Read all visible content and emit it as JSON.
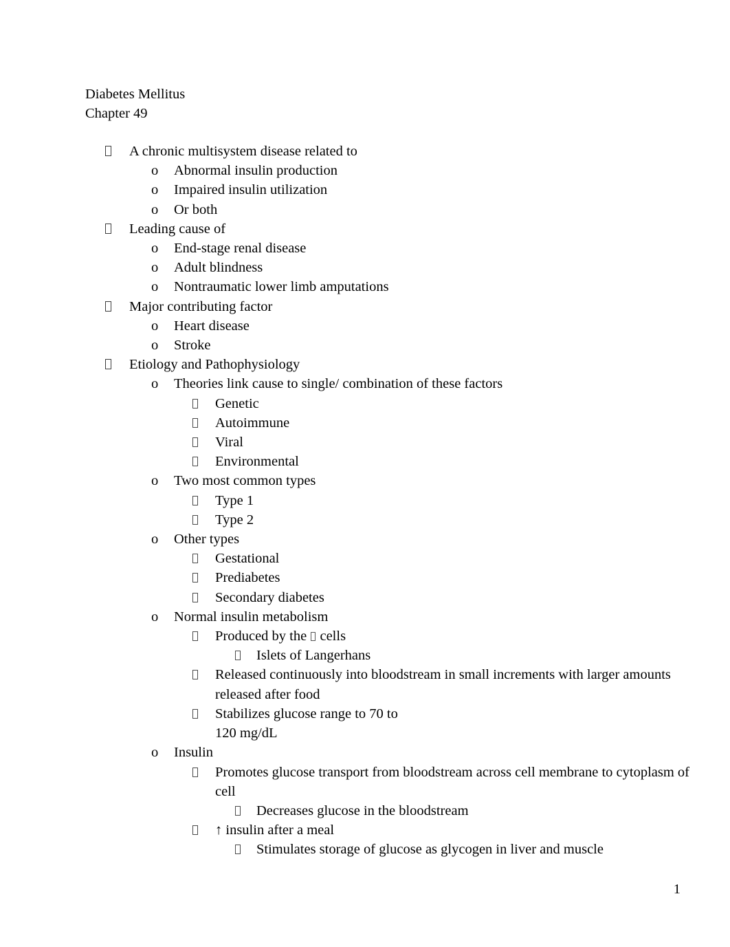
{
  "document": {
    "title_lines": [
      "Diabetes Mellitus",
      "Chapter 49"
    ],
    "page_number": "1",
    "text_color": "#000000",
    "background_color": "#ffffff",
    "bullet_glyphs": {
      "level1": "missing-glyph-box",
      "level2": "o",
      "level3": "missing-glyph-box",
      "level4": "missing-glyph-box"
    }
  },
  "outline": [
    {
      "level": 1,
      "text": "A chronic multisystem disease related to"
    },
    {
      "level": 2,
      "text": "Abnormal insulin production"
    },
    {
      "level": 2,
      "text": "Impaired insulin utilization"
    },
    {
      "level": 2,
      "text": "Or both"
    },
    {
      "level": 1,
      "text": "Leading cause of"
    },
    {
      "level": 2,
      "text": "End-stage renal disease"
    },
    {
      "level": 2,
      "text": "Adult blindness"
    },
    {
      "level": 2,
      "text": "Nontraumatic lower limb amputations"
    },
    {
      "level": 1,
      "text": " Major contributing factor"
    },
    {
      "level": 2,
      "text": "Heart disease"
    },
    {
      "level": 2,
      "text": "Stroke"
    },
    {
      "level": 1,
      "text": "Etiology and Pathophysiology"
    },
    {
      "level": 2,
      "text": "Theories link cause to single/ combination of these factors"
    },
    {
      "level": 3,
      "text": "Genetic"
    },
    {
      "level": 3,
      "text": "Autoimmune"
    },
    {
      "level": 3,
      "text": "Viral"
    },
    {
      "level": 3,
      "text": "Environmental"
    },
    {
      "level": 2,
      "text": "Two most common types"
    },
    {
      "level": 3,
      "text": "Type 1"
    },
    {
      "level": 3,
      "text": "Type 2"
    },
    {
      "level": 2,
      "text": "Other types"
    },
    {
      "level": 3,
      "text": "Gestational"
    },
    {
      "level": 3,
      "text": "Prediabetes"
    },
    {
      "level": 3,
      "text": "Secondary diabetes"
    },
    {
      "level": 2,
      "text": "Normal insulin metabolism"
    },
    {
      "level": 3,
      "text_before_symbol": "Produced by the ",
      "symbol": "beta-missing-glyph",
      "text_after_symbol": " cells"
    },
    {
      "level": 4,
      "text": "Islets of Langerhans"
    },
    {
      "level": 3,
      "text": "Released continuously into bloodstream in small increments with larger amounts released after food"
    },
    {
      "level": 3,
      "line1": "Stabilizes glucose range to 70 to",
      "line2": "120 mg/dL"
    },
    {
      "level": 2,
      "text": "Insulin"
    },
    {
      "level": 3,
      "text": "Promotes glucose transport from bloodstream across cell membrane to cytoplasm of cell"
    },
    {
      "level": 4,
      "text": "Decreases glucose in the bloodstream"
    },
    {
      "level": 3,
      "text": "↑ insulin after a meal"
    },
    {
      "level": 4,
      "text": "Stimulates storage of glucose as glycogen in liver and muscle"
    }
  ]
}
